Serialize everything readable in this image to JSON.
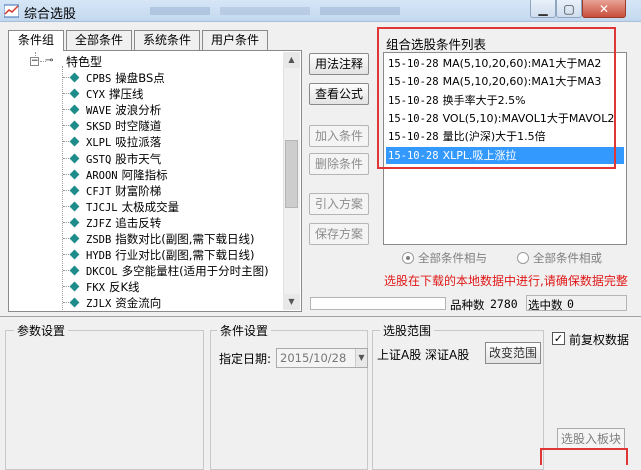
{
  "window": {
    "title": "综合选股"
  },
  "tabs": [
    {
      "label": "条件组",
      "active": true
    },
    {
      "label": "全部条件",
      "active": false
    },
    {
      "label": "系统条件",
      "active": false
    },
    {
      "label": "用户条件",
      "active": false
    }
  ],
  "tree": {
    "group_label": "特色型",
    "items": [
      {
        "code": "CPBS",
        "name": "操盘BS点"
      },
      {
        "code": "CYX",
        "name": "撑压线"
      },
      {
        "code": "WAVE",
        "name": "波浪分析"
      },
      {
        "code": "SKSD",
        "name": "时空隧道"
      },
      {
        "code": "XLPL",
        "name": "吸拉派落"
      },
      {
        "code": "GSTQ",
        "name": "股市天气"
      },
      {
        "code": "AROON",
        "name": "阿隆指标"
      },
      {
        "code": "CFJT",
        "name": "财富阶梯"
      },
      {
        "code": "TJCJL",
        "name": "太极成交量"
      },
      {
        "code": "ZJFZ",
        "name": "追击反转"
      },
      {
        "code": "ZSDB",
        "name": "指数对比(副图,需下载日线)"
      },
      {
        "code": "HYDB",
        "name": "行业对比(副图,需下载日线)"
      },
      {
        "code": "DKCOL",
        "name": "多空能量柱(适用于分时主图)"
      },
      {
        "code": "FKX",
        "name": "反K线"
      },
      {
        "code": "ZJLX",
        "name": "资金流向"
      }
    ]
  },
  "buttons": {
    "usage": "用法注释",
    "formula": "查看公式",
    "add_condition": "加入条件",
    "delete_condition": "删除条件",
    "import_plan": "引入方案",
    "save_plan": "保存方案"
  },
  "condition_list": {
    "label": "组合选股条件列表",
    "items": [
      {
        "date": "15-10-28",
        "text": "MA(5,10,20,60):MA1大于MA2",
        "selected": false
      },
      {
        "date": "15-10-28",
        "text": "MA(5,10,20,60):MA1大于MA3",
        "selected": false
      },
      {
        "date": "15-10-28",
        "text": "换手率大于2.5%",
        "selected": false
      },
      {
        "date": "15-10-28",
        "text": "VOL(5,10):MAVOL1大于MAVOL2",
        "selected": false
      },
      {
        "date": "15-10-28",
        "text": "量比(沪深)大于1.5倍",
        "selected": false
      },
      {
        "date": "15-10-28",
        "text": "XLPL.吸上涨拉",
        "selected": true
      }
    ]
  },
  "radios": {
    "and_label": "全部条件相与",
    "or_label": "全部条件相或",
    "selected": "and"
  },
  "warning": "选股在下载的本地数据中进行,请确保数据完整",
  "stats": {
    "count_label": "品种数",
    "count_value": "2780",
    "selected_label": "选中数",
    "selected_value": "0"
  },
  "param_group": {
    "title": "参数设置"
  },
  "condition_settings": {
    "title": "条件设置",
    "date_label": "指定日期:",
    "date_value": "2015/10/28"
  },
  "range": {
    "title": "选股范围",
    "value": "上证A股 深证A股",
    "change_button": "改变范围"
  },
  "adjust": {
    "label": "前复权数据",
    "checked": true
  },
  "select_block_button": "选股入板块",
  "colors": {
    "highlight": "#3399ff",
    "warning": "#e01818",
    "annotation": "#e03636"
  }
}
